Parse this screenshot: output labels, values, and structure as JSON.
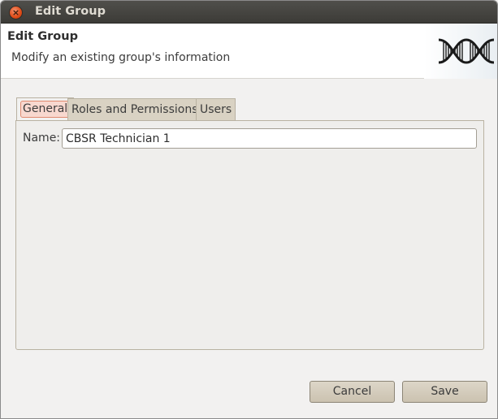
{
  "window": {
    "title": "Edit Group"
  },
  "header": {
    "title": "Edit Group",
    "subtitle": "Modify an existing group's information",
    "logo_icon": "dna-helix-icon"
  },
  "tabs": [
    {
      "label": "General",
      "active": true
    },
    {
      "label": "Roles and Permissions",
      "active": false
    },
    {
      "label": "Users",
      "active": false
    }
  ],
  "form": {
    "name_label": "Name:",
    "name_value": "CBSR Technician 1"
  },
  "buttons": {
    "cancel_label": "Cancel",
    "save_label": "Save"
  },
  "colors": {
    "titlebar": "#3c3b37",
    "close_button": "#df4a16",
    "active_tab_highlight": "#f8d8cf",
    "tab_background": "#d9d2c3"
  }
}
